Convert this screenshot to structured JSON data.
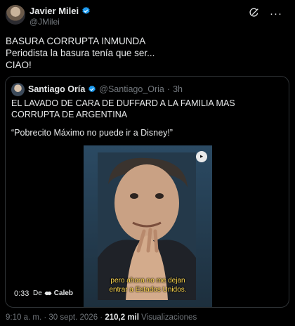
{
  "post": {
    "author_name": "Javier Milei",
    "author_handle": "@JMilei",
    "text_lines": [
      "BASURA CORRUPTA INMUNDA",
      "Periodista la basura tenía que ser...",
      "CIAO!"
    ]
  },
  "quote": {
    "author_name": "Santiago Oría",
    "author_handle": "@Santiago_Oria",
    "separator": "·",
    "time": "3h",
    "text_p1": "EL LAVADO DE CARA DE DUFFARD A LA FAMILIA MAS CORRUPTA DE ARGENTINA",
    "text_p2": "“Pobrecito Máximo no puede ir a Disney!”",
    "video": {
      "subtitle_line1": "pero ahora no me dejan",
      "subtitle_line2": "entrar a Estados Unidos.",
      "duration": "0:33",
      "from_label": "De",
      "from_name": "Caleb"
    }
  },
  "footer": {
    "time": "9:10 a. m.",
    "separator": "·",
    "date": "30 sept. 2026",
    "views_count": "210,2 mil",
    "views_label": "Visualizaciones"
  },
  "icons": {
    "verified": "verified-badge-icon",
    "grok": "grok-icon",
    "more": "more-options-icon"
  },
  "colors": {
    "background": "#000000",
    "text": "#e7e9ea",
    "secondary": "#71767b",
    "verified": "#1d9bf0",
    "subtitle": "#ffd84d"
  }
}
